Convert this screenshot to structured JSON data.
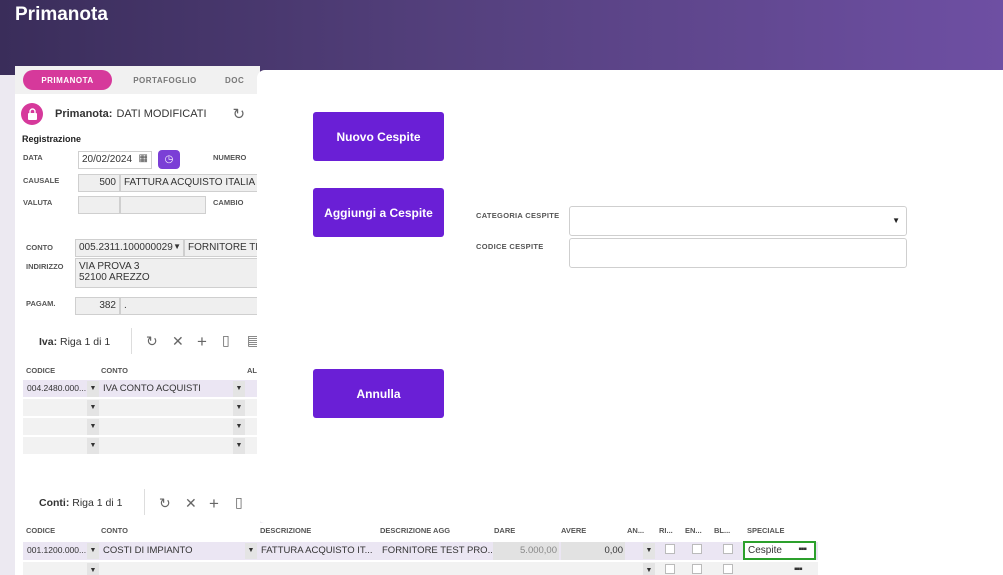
{
  "app": {
    "title": "Primanota"
  },
  "tabs": [
    {
      "label": "PRIMANOTA"
    },
    {
      "label": "PORTAFOGLIO"
    },
    {
      "label": "DOC"
    }
  ],
  "status": {
    "label": "Primanota:",
    "value": "DATI MODIFICATI"
  },
  "registrazione": {
    "title": "Registrazione",
    "data_label": "DATA",
    "data_value": "20/02/2024",
    "numero_label": "NUMERO",
    "causale_label": "CAUSALE",
    "causale_code": "500",
    "causale_desc": "FATTURA ACQUISTO ITALIA",
    "valuta_label": "VALUTA",
    "cambio_label": "CAMBIO",
    "conto_label": "CONTO",
    "conto_value": "005.2311.100000029",
    "conto_desc": "FORNITORE TEST",
    "indirizzo_label": "INDIRIZZO",
    "indirizzo_line1": "VIA PROVA 3",
    "indirizzo_line2": "52100 AREZZO",
    "pagam_label": "PAGAM.",
    "pagam_code": "382",
    "pagam_desc": "."
  },
  "iva": {
    "title": "Iva:",
    "rows_info": "Riga 1 di 1",
    "headers": {
      "codice": "CODICE",
      "conto": "CONTO",
      "al": "AL"
    },
    "rows": [
      {
        "codice": "004.2480.000...",
        "conto": "IVA CONTO ACQUISTI"
      }
    ]
  },
  "conti": {
    "title": "Conti:",
    "rows_info": "Riga 1 di 1",
    "headers": {
      "codice": "CODICE",
      "conto": "CONTO",
      "descrizione": "DESCRIZIONE",
      "descrizione_agg": "DESCRIZIONE AGG",
      "dare": "DARE",
      "avere": "AVERE",
      "an": "AN...",
      "ri": "RI...",
      "en": "EN...",
      "bl": "BL...",
      "speciale": "SPECIALE"
    },
    "rows": [
      {
        "codice": "001.1200.000...",
        "conto": "COSTI DI IMPIANTO",
        "descrizione": "FATTURA ACQUISTO IT...",
        "descrizione_agg": "FORNITORE TEST PRO...",
        "dare": "5.000,00",
        "avere": "0,00",
        "speciale": "Cespite"
      }
    ]
  },
  "modal": {
    "nuovo_button": "Nuovo Cespite",
    "aggiungi_button": "Aggiungi a Cespite",
    "annulla_button": "Annulla",
    "categoria_label": "CATEGORIA CESPITE",
    "categoria_value": "",
    "codice_label": "CODICE CESPITE",
    "codice_value": ""
  },
  "colors": {
    "accent": "#6a1fd6",
    "tab_active": "#d6399b",
    "header_start": "#3a2d5a",
    "header_end": "#6e4fa3",
    "highlight": "#2ca02c"
  }
}
